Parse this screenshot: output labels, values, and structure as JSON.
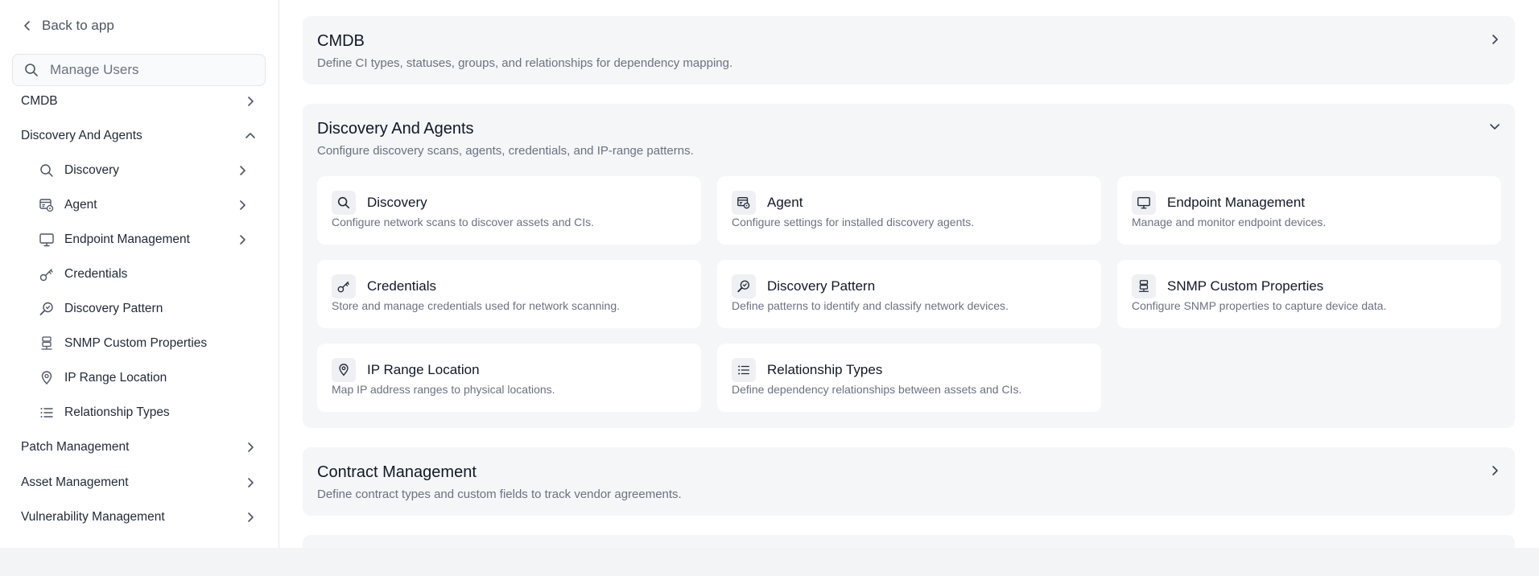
{
  "sidebar": {
    "back_label": "Back to app",
    "search_placeholder": "Manage Users",
    "items": [
      {
        "label": "CMDB"
      },
      {
        "label": "Discovery And Agents"
      },
      {
        "label": "Patch Management"
      },
      {
        "label": "Asset Management"
      },
      {
        "label": "Vulnerability Management"
      }
    ],
    "sub_items": [
      {
        "label": "Discovery",
        "icon": "search-icon"
      },
      {
        "label": "Agent",
        "icon": "agent-icon"
      },
      {
        "label": "Endpoint Management",
        "icon": "monitor-icon"
      },
      {
        "label": "Credentials",
        "icon": "key-icon"
      },
      {
        "label": "Discovery Pattern",
        "icon": "pattern-search-icon"
      },
      {
        "label": "SNMP Custom Properties",
        "icon": "server-icon"
      },
      {
        "label": "IP Range Location",
        "icon": "location-pin-icon"
      },
      {
        "label": "Relationship Types",
        "icon": "list-icon"
      }
    ]
  },
  "main": {
    "sections": [
      {
        "title": "CMDB",
        "description": "Define CI types, statuses, groups, and relationships for dependency mapping.",
        "expanded": false
      },
      {
        "title": "Discovery And Agents",
        "description": "Configure discovery scans, agents, credentials, and IP-range patterns.",
        "expanded": true
      },
      {
        "title": "Contract Management",
        "description": "Define contract types and custom fields to track vendor agreements.",
        "expanded": false
      }
    ],
    "cards": [
      {
        "title": "Discovery",
        "description": "Configure network scans to discover assets and CIs.",
        "icon": "search-icon"
      },
      {
        "title": "Agent",
        "description": "Configure settings for installed discovery agents.",
        "icon": "agent-icon"
      },
      {
        "title": "Endpoint Management",
        "description": "Manage and monitor endpoint devices.",
        "icon": "monitor-icon"
      },
      {
        "title": "Credentials",
        "description": "Store and manage credentials used for network scanning.",
        "icon": "key-icon"
      },
      {
        "title": "Discovery Pattern",
        "description": "Define patterns to identify and classify network devices.",
        "icon": "pattern-search-icon"
      },
      {
        "title": "SNMP Custom Properties",
        "description": "Configure SNMP properties to capture device data.",
        "icon": "server-icon"
      },
      {
        "title": "IP Range Location",
        "description": "Map IP address ranges to physical locations.",
        "icon": "location-pin-icon"
      },
      {
        "title": "Relationship Types",
        "description": "Define dependency relationships between assets and CIs.",
        "icon": "list-icon"
      }
    ]
  },
  "colors": {
    "background": "#f3f4f6",
    "panel": "#ffffff",
    "section_bg": "#f4f6f8",
    "text_primary": "#111827",
    "text_secondary": "#6b7280",
    "border": "#e5e7eb"
  }
}
